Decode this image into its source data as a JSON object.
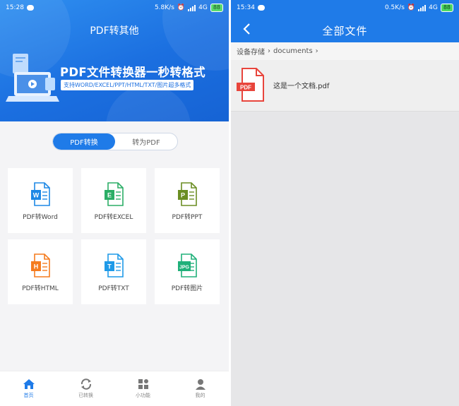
{
  "left": {
    "status": {
      "time": "15:28",
      "speed": "5.8K/s",
      "network": "4G",
      "battery": "88"
    },
    "title": "PDF转其他",
    "banner": {
      "slogan": "PDF文件转换器一秒转格式",
      "subslogan": "支持WORD/EXCEL/PPT/HTML/TXT/图片超多格式"
    },
    "toggle": {
      "active": "PDF转换",
      "inactive": "转为PDF"
    },
    "tiles": [
      {
        "label": "PDF转Word",
        "letter": "W",
        "color": "#1e88e5",
        "icon": "word-doc-icon"
      },
      {
        "label": "PDF转EXCEL",
        "letter": "E",
        "color": "#2bae66",
        "icon": "excel-doc-icon"
      },
      {
        "label": "PDF转PPT",
        "letter": "P",
        "color": "#6b8e23",
        "icon": "ppt-doc-icon"
      },
      {
        "label": "PDF转HTML",
        "letter": "H",
        "color": "#f57c1f",
        "icon": "html-doc-icon"
      },
      {
        "label": "PDF转TXT",
        "letter": "T",
        "color": "#1f9ae8",
        "icon": "txt-doc-icon"
      },
      {
        "label": "PDF转图片",
        "letter": "JPG",
        "color": "#20b07a",
        "icon": "image-doc-icon"
      }
    ],
    "nav": [
      {
        "label": "首页",
        "icon": "home-icon"
      },
      {
        "label": "已转换",
        "icon": "refresh-icon"
      },
      {
        "label": "小功能",
        "icon": "apps-icon"
      },
      {
        "label": "我的",
        "icon": "person-icon"
      }
    ]
  },
  "right": {
    "status": {
      "time": "15:34",
      "speed": "0.5K/s",
      "network": "4G",
      "battery": "88"
    },
    "title": "全部文件",
    "breadcrumb": [
      "设备存储",
      "documents"
    ],
    "file": {
      "name": "这是一个文档.pdf",
      "badge": "PDF"
    }
  },
  "colors": {
    "primary": "#1f7be8",
    "pdf_red": "#e8453c"
  }
}
